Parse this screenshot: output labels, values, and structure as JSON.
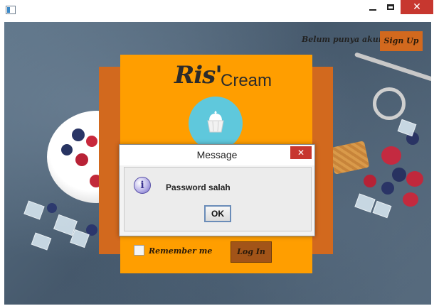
{
  "window": {
    "close_glyph": "✕"
  },
  "header": {
    "signup_prompt": "Belum punya akun?",
    "signup_button": "Sign Up"
  },
  "brand": {
    "part1": "Ris'",
    "part2": "Cream",
    "logo_icon": "cupcake-icon"
  },
  "form": {
    "remember_label": "Remember me",
    "login_button": "Log In"
  },
  "dialog": {
    "title": "Message",
    "close_glyph": "✕",
    "icon": "info-icon",
    "icon_glyph": "i",
    "message": "Password salah",
    "ok_button": "OK"
  },
  "colors": {
    "accent_orange": "#ff9e00",
    "card_shadow_orange": "#d2691e",
    "logo_circle": "#5fc8dc",
    "close_red": "#c7372f"
  }
}
